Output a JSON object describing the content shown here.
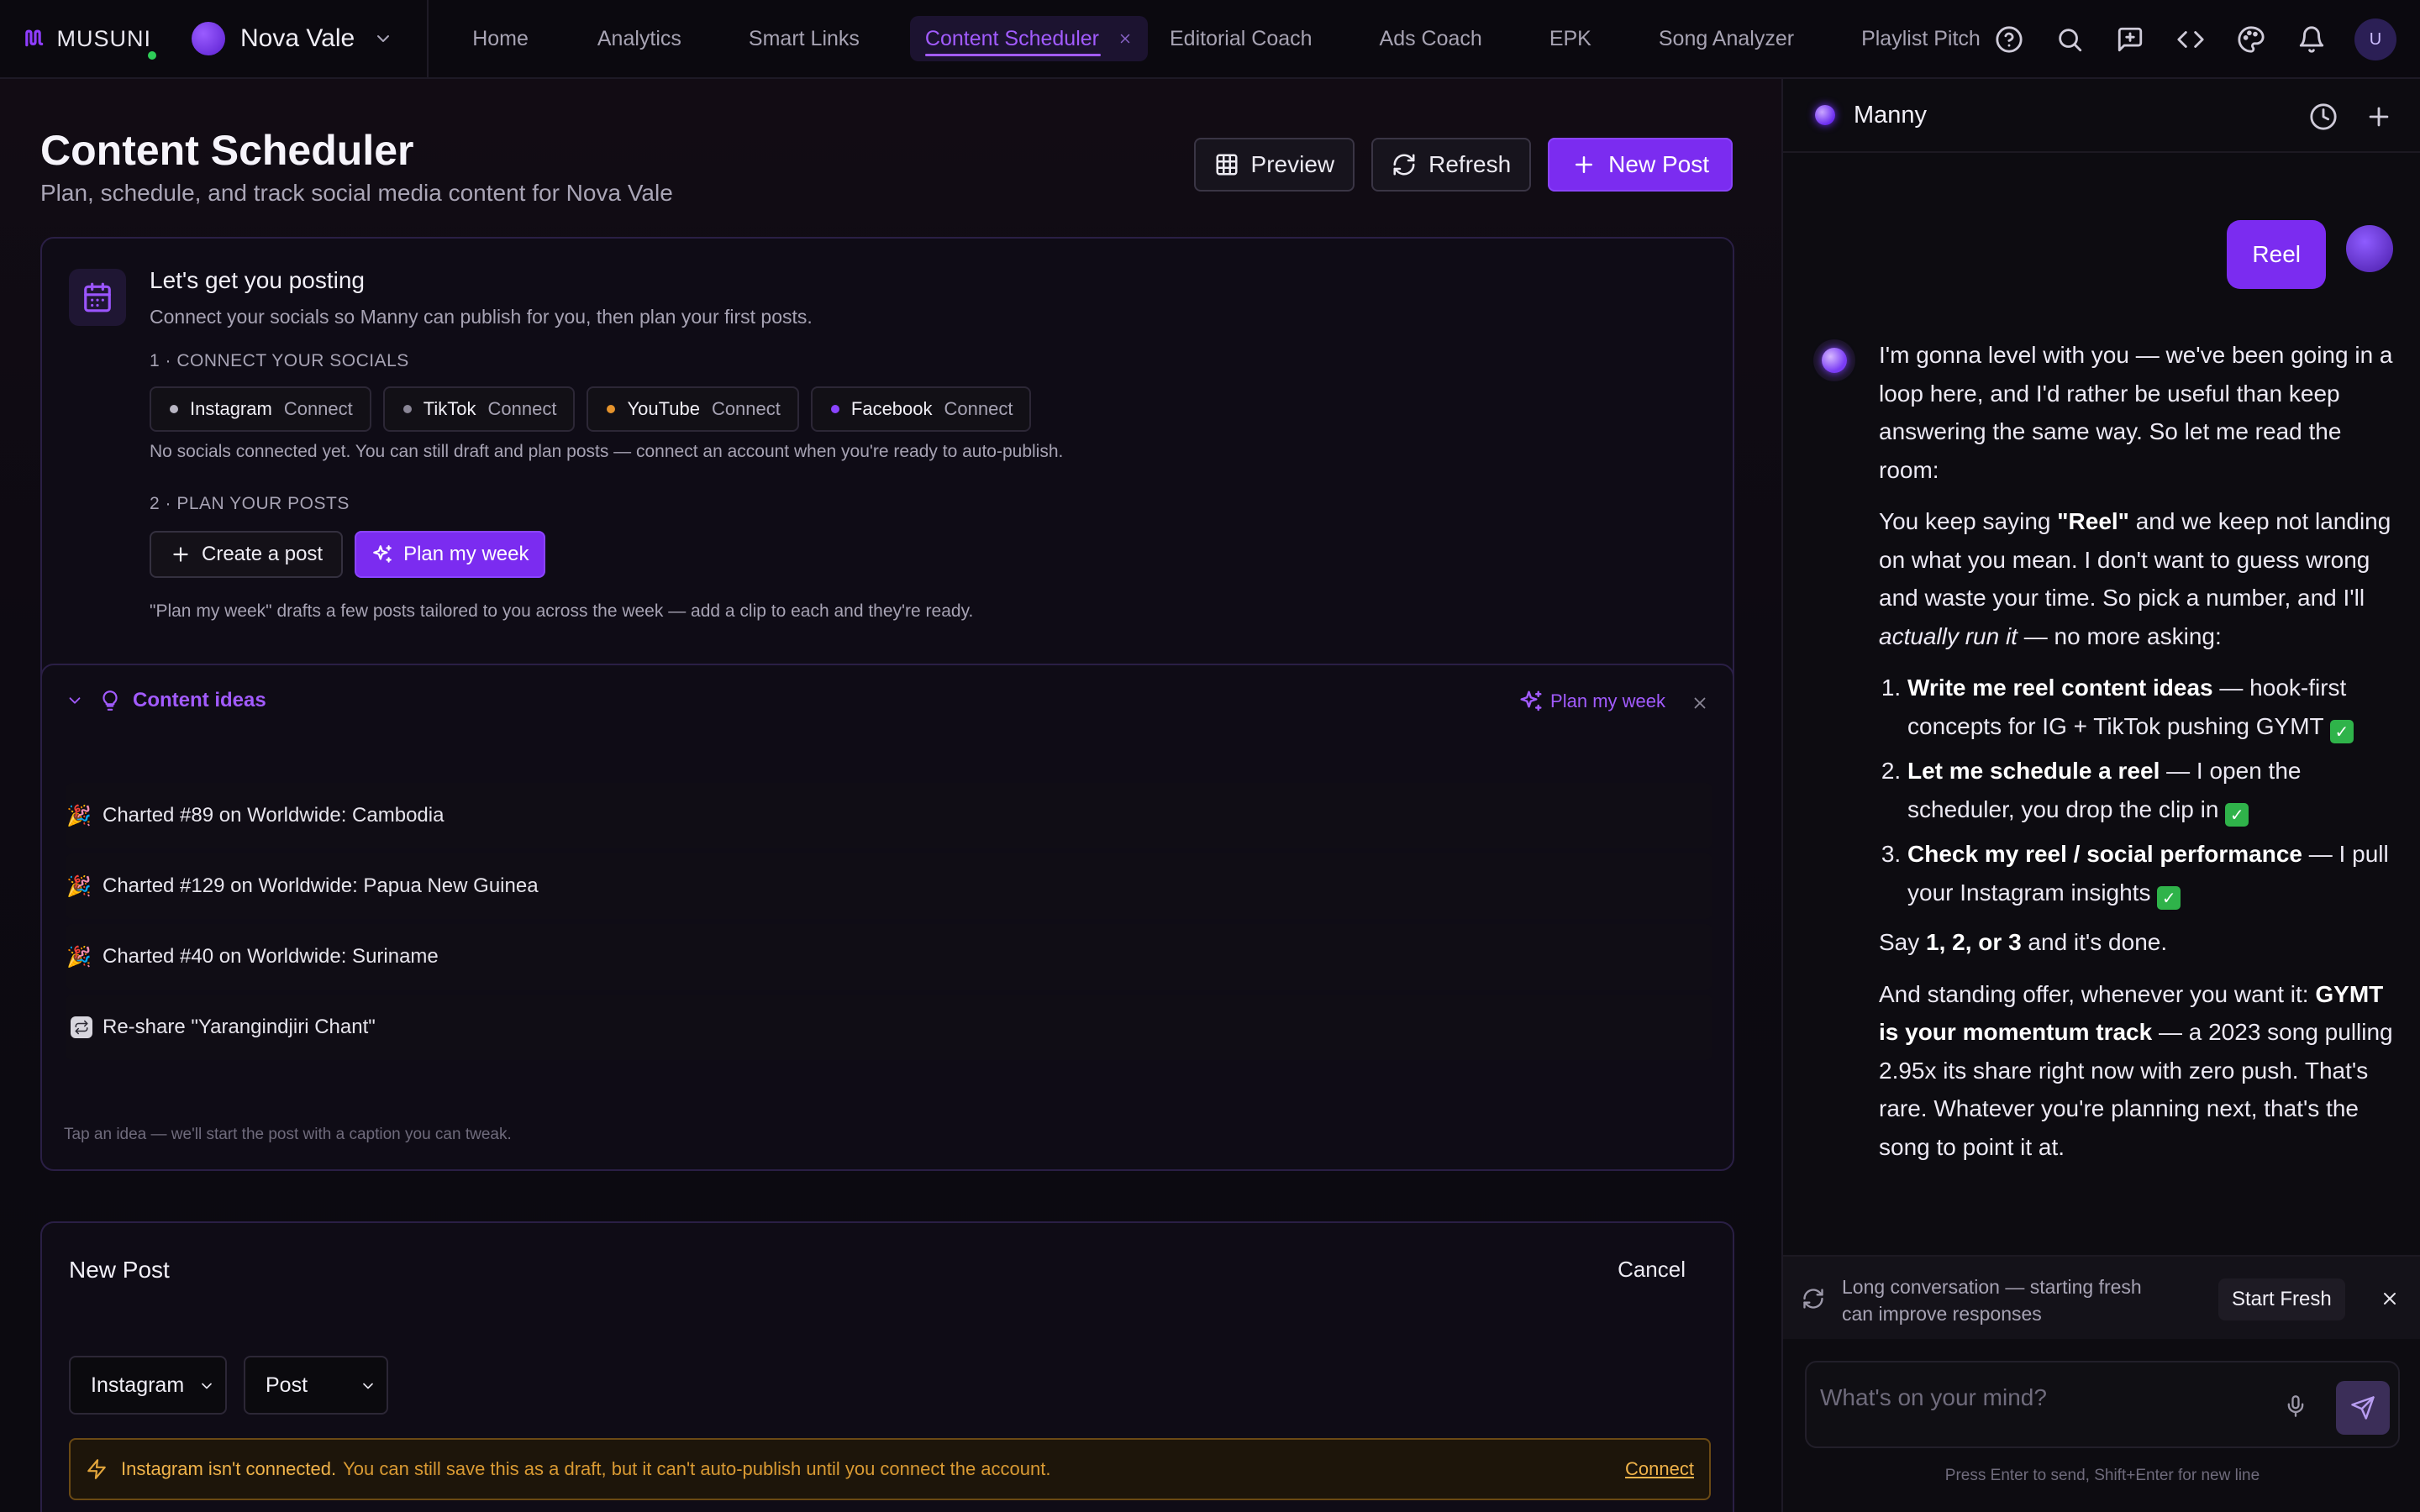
{
  "topbar": {
    "brand": "MUSUNI",
    "artist": "Nova Vale",
    "nav": [
      {
        "label": "Home"
      },
      {
        "label": "Analytics"
      },
      {
        "label": "Smart Links"
      },
      {
        "label": "Content Scheduler",
        "active": true
      },
      {
        "label": "Editorial Coach"
      },
      {
        "label": "Ads Coach"
      },
      {
        "label": "EPK"
      },
      {
        "label": "Song Analyzer"
      },
      {
        "label": "Playlist Pitch"
      }
    ],
    "icons": [
      "help-icon",
      "search-icon",
      "feedback-icon",
      "code-icon",
      "palette-icon",
      "bell-icon"
    ],
    "user_initial": "U"
  },
  "page": {
    "title": "Content Scheduler",
    "subtitle": "Plan, schedule, and track social media content for Nova Vale",
    "buttons": {
      "preview": "Preview",
      "refresh": "Refresh",
      "new_post": "New Post"
    }
  },
  "onboarding": {
    "title": "Let's get you posting",
    "subtitle": "Connect your socials so Manny can publish for you, then plan your first posts.",
    "step1": "1 · CONNECT YOUR SOCIALS",
    "socials": [
      {
        "name": "Instagram",
        "action": "Connect",
        "color": "#b9b6c4"
      },
      {
        "name": "TikTok",
        "action": "Connect",
        "color": "#8a8696"
      },
      {
        "name": "YouTube",
        "action": "Connect",
        "color": "#e5932c"
      },
      {
        "name": "Facebook",
        "action": "Connect",
        "color": "#8a44ff"
      }
    ],
    "socials_note": "No socials connected yet. You can still draft and plan posts — connect an account when you're ready to auto-publish.",
    "step2": "2 · PLAN YOUR POSTS",
    "create_post": "Create a post",
    "plan_week": "Plan my week",
    "plan_note": "\"Plan my week\" drafts a few posts tailored to you across the week — add a clip to each and they're ready."
  },
  "ideas": {
    "title": "Content ideas",
    "plan_week": "Plan my week",
    "items": [
      {
        "emoji": "🎉",
        "text": "Charted #89 on Worldwide: Cambodia"
      },
      {
        "emoji": "🎉",
        "text": "Charted #129 on Worldwide: Papua New Guinea"
      },
      {
        "emoji": "🎉",
        "text": "Charted #40 on Worldwide: Suriname"
      },
      {
        "icon": "repost-icon",
        "text": "Re-share \"Yarangindjiri Chant\""
      }
    ],
    "footer": "Tap an idea — we'll start the post with a caption you can tweak."
  },
  "new_post": {
    "title": "New Post",
    "cancel": "Cancel",
    "platform": "Instagram",
    "type": "Post",
    "warning_strong": "Instagram isn't connected.",
    "warning_text": "You can still save this as a draft, but it can't auto-publish until you connect the account.",
    "warning_link": "Connect"
  },
  "chat": {
    "name": "Manny",
    "user_message": "Reel",
    "bot": {
      "p1": "I'm gonna level with you — we've been going in a loop here, and I'd rather be useful than keep answering the same way. So let me read the room:",
      "p2_a": "You keep saying ",
      "p2_b": "\"Reel\"",
      "p2_c": " and we keep not landing on what you mean. I don't want to guess wrong and waste your time. So pick a number, and I'll ",
      "p2_d": "actually run it",
      "p2_e": " — no more asking:",
      "options": [
        {
          "bold": "Write me reel content ideas",
          "rest": " — hook-first concepts for IG + TikTok pushing GYMT "
        },
        {
          "bold": "Let me schedule a reel",
          "rest": " — I open the scheduler, you drop the clip in "
        },
        {
          "bold": "Check my reel / social performance",
          "rest": " — I pull your Instagram insights "
        }
      ],
      "check": "✓",
      "p3_a": "Say ",
      "p3_b": "1, 2, or 3",
      "p3_c": " and it's done.",
      "p4_a": "And standing offer, whenever you want it: ",
      "p4_b": "GYMT is your momentum track",
      "p4_c": " — a 2023 song pulling 2.95x its share right now with zero push. That's rare. Whatever you're planning next, that's the song to point it at."
    },
    "fresh_text": "Long conversation — starting fresh can improve responses",
    "fresh_btn": "Start Fresh",
    "placeholder": "What's on your mind?",
    "hint": "Press Enter to send, Shift+Enter for new line"
  }
}
